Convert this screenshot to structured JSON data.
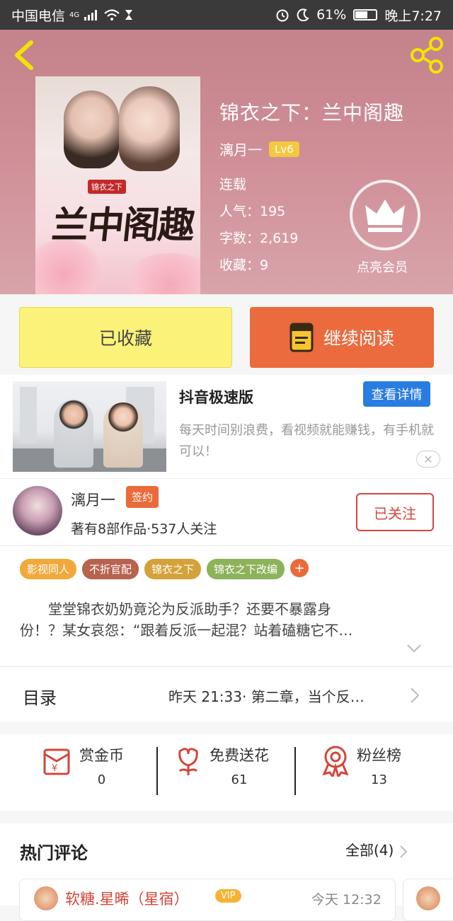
{
  "status_bar": {
    "carrier": "中国电信",
    "network": "4G",
    "battery": "61%",
    "battery_level": 0.61,
    "time": "晚上7:27"
  },
  "book": {
    "title": "锦衣之下：兰中阁趣",
    "author": "漓月一",
    "level": "Lv6",
    "status": "连载",
    "popularity": "人气：195",
    "word_count": "字数：2,619",
    "favorites": "收藏：9",
    "vip_label": "点亮会员",
    "cover_title": "兰中阁趣",
    "cover_tag": "锦衣之下"
  },
  "actions": {
    "favorited": "已收藏",
    "continue_reading": "继续阅读"
  },
  "ad": {
    "title": "抖音极速版",
    "button": "查看详情",
    "description": "每天时间别浪费，看视频就能赚钱，有手机就可以！",
    "close": "✕"
  },
  "author_card": {
    "name": "漓月一",
    "badge": "签约",
    "stats": "著有8部作品·537人关注",
    "follow_button": "已关注"
  },
  "tags": [
    {
      "label": "影视同人",
      "color": "#f1a93b"
    },
    {
      "label": "不折官配",
      "color": "#b8634f"
    },
    {
      "label": "锦衣之下",
      "color": "#d3a23a"
    },
    {
      "label": "锦衣之下改编",
      "color": "#8cb35a"
    }
  ],
  "tag_add": "+",
  "synopsis": {
    "line1": "堂堂锦衣奶奶竟沦为反派助手？还要不暴露身",
    "line2": "份！？某女哀怨：“跟着反派一起混？站着磕糖它不…"
  },
  "toc": {
    "label": "目录",
    "latest": "昨天 21:33· 第二章，当个反…"
  },
  "stats": [
    {
      "label": "赏金币",
      "value": "0",
      "icon": "red-envelope-icon"
    },
    {
      "label": "免费送花",
      "value": "61",
      "icon": "flower-icon"
    },
    {
      "label": "粉丝榜",
      "value": "13",
      "icon": "medal-icon"
    }
  ],
  "comments": {
    "title": "热门评论",
    "all": "全部(4)",
    "first": {
      "user": "软糖.星晞（星宿）",
      "badge": "VIP",
      "time": "今天 12:32"
    }
  },
  "colors": {
    "accent_orange": "#eb6a3e",
    "favorite_yellow": "#fbf27a",
    "follow_red": "#d6453a",
    "ad_blue": "#2a7de0"
  }
}
